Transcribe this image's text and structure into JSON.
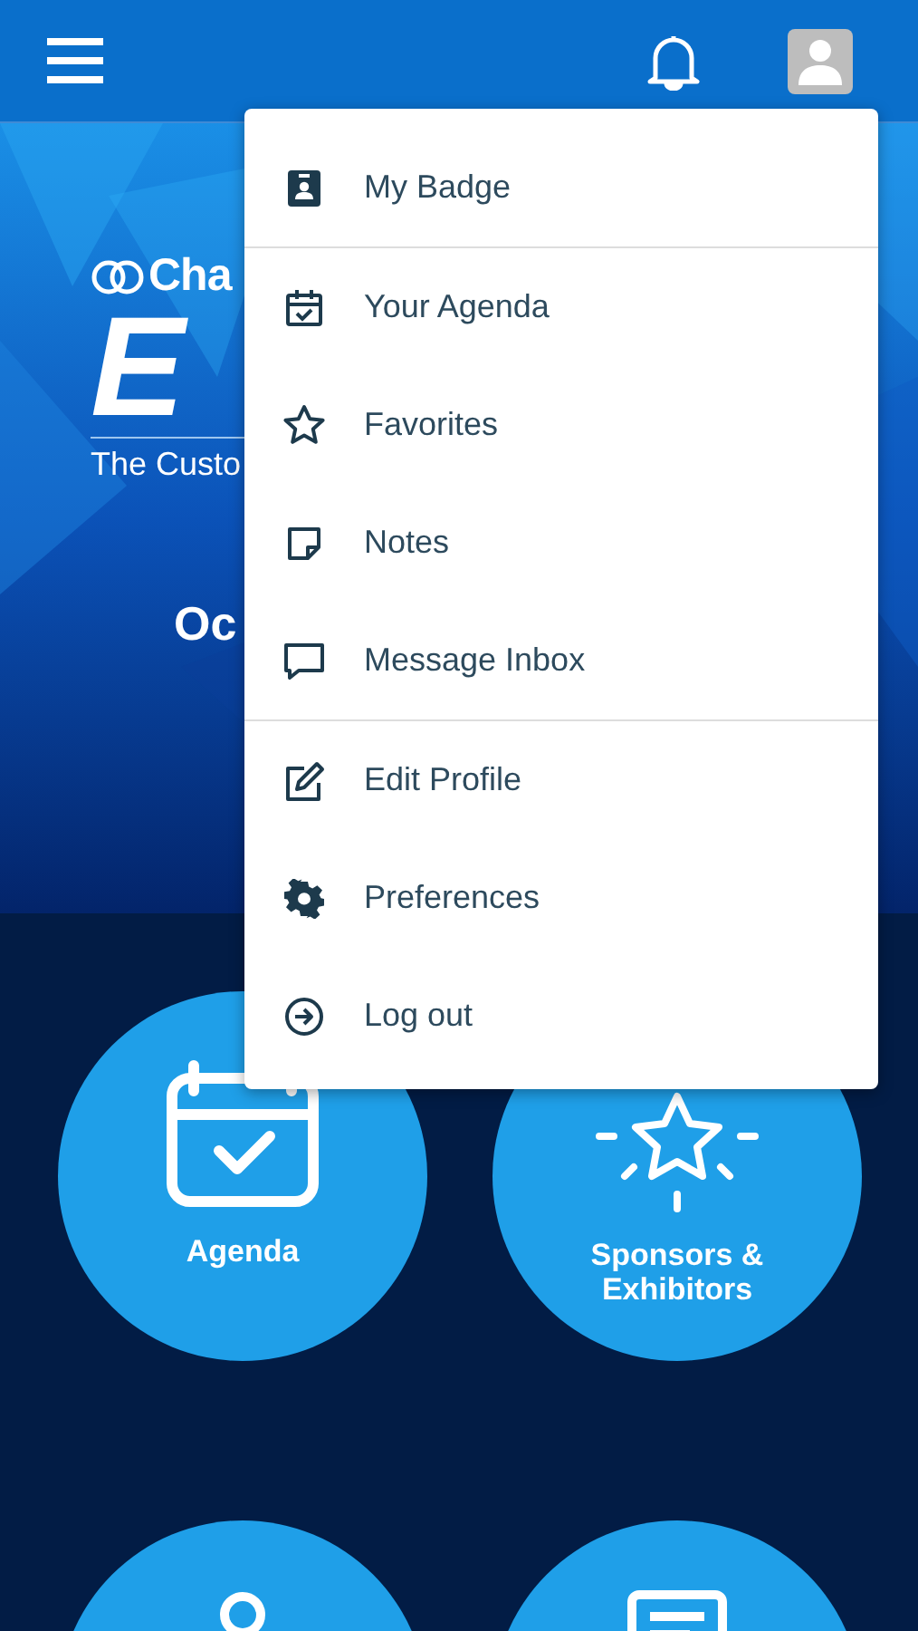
{
  "hero": {
    "logo_text": "Cha",
    "title_text": "E",
    "tagline": "The Custo",
    "date": "Oc"
  },
  "menu": {
    "groups": [
      {
        "items": [
          {
            "label": "My Badge"
          }
        ]
      },
      {
        "items": [
          {
            "label": "Your Agenda"
          },
          {
            "label": "Favorites"
          },
          {
            "label": "Notes"
          },
          {
            "label": "Message Inbox"
          }
        ]
      },
      {
        "items": [
          {
            "label": "Edit Profile"
          },
          {
            "label": "Preferences"
          },
          {
            "label": "Log out"
          }
        ]
      }
    ]
  },
  "tiles": [
    {
      "kind": "labeled",
      "label": "Agenda"
    },
    {
      "kind": "labeled",
      "label": "Sponsors & Exhibitors"
    },
    {
      "kind": "cut"
    },
    {
      "kind": "cut"
    }
  ]
}
